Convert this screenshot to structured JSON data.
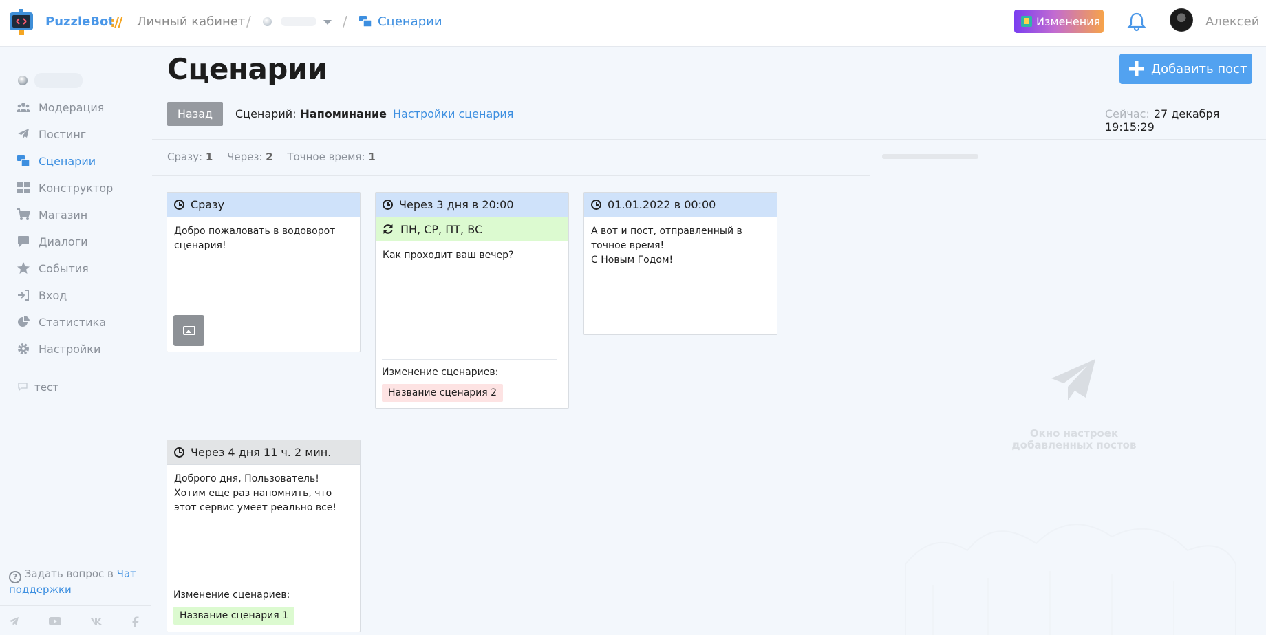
{
  "header": {
    "brand": "PuzzleBot",
    "brand_sep": "://",
    "crumb_cabinet": "Личный кабинет",
    "crumb_sep": "/",
    "crumb_active": "Сценарии",
    "changes_label": "Изменения",
    "username": "Алексей"
  },
  "sidebar": {
    "items": [
      {
        "label": "Модерация",
        "icon": "users-icon"
      },
      {
        "label": "Постинг",
        "icon": "paper-plane-icon"
      },
      {
        "label": "Сценарии",
        "icon": "scenarios-icon"
      },
      {
        "label": "Конструктор",
        "icon": "grid-icon"
      },
      {
        "label": "Магазин",
        "icon": "cart-icon"
      },
      {
        "label": "Диалоги",
        "icon": "chat-icon"
      },
      {
        "label": "События",
        "icon": "star-icon"
      },
      {
        "label": "Вход",
        "icon": "sign-in-icon"
      },
      {
        "label": "Статистика",
        "icon": "pie-chart-icon"
      },
      {
        "label": "Настройки",
        "icon": "gear-icon"
      }
    ],
    "test_label": "тест",
    "support_text": "Задать вопрос в ",
    "support_link": "Чат поддержки",
    "support_q": "?",
    "socials": [
      "telegram-icon",
      "youtube-icon",
      "vk-icon",
      "facebook-icon"
    ]
  },
  "main": {
    "title": "Сценарии",
    "add_post": "Добавить пост",
    "back": "Назад",
    "scenario_label": "Сценарий:",
    "scenario_name": "Напоминание",
    "scenario_settings": "Настройки сценария",
    "now_label": "Сейчас:",
    "now_value": "27 декабря 19:15:29",
    "counts": {
      "immediate_label": "Сразу:",
      "immediate_value": "1",
      "after_label": "Через:",
      "after_value": "2",
      "exact_label": "Точное время:",
      "exact_value": "1"
    }
  },
  "cards": [
    {
      "head": "Сразу",
      "text": "Добро пожаловать в водоворот сценария!"
    },
    {
      "head": "Через 3 дня в 20:00",
      "repeat": "ПН, СР, ПТ, ВС",
      "text": "Как проходит ваш вечер?",
      "change_label": "Изменение сценариев:",
      "chip": "Название сценария 2"
    },
    {
      "head": "01.01.2022 в 00:00",
      "text": "А вот и пост, отправленный в точное время!\nС Новым Годом!"
    },
    {
      "head": "Через 4 дня 11 ч. 2 мин.",
      "text": "Доброго дня, Пользователь! Хотим еще раз напомнить, что этот сервис умеет реально все!",
      "change_label": "Изменение сценариев:",
      "chip": "Название сценария 1"
    }
  ],
  "right_panel": {
    "placeholder": "Окно настроек добавленных постов"
  }
}
